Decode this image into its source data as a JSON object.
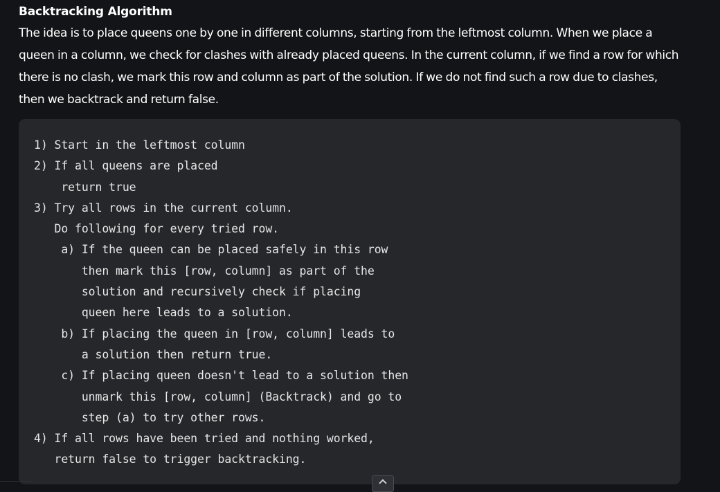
{
  "article": {
    "heading": "Backtracking Algorithm",
    "intro": "The idea is to place queens one by one in different columns, starting from the leftmost column. When we place a queen in a column, we check for clashes with already placed queens. In the current column, if we find a row for which there is no clash, we mark this row and column as part of the solution. If we do not find such a row due to clashes, then we backtrack and return false."
  },
  "code": {
    "lines": [
      "1) Start in the leftmost column",
      "2) If all queens are placed",
      "    return true",
      "3) Try all rows in the current column.",
      "   Do following for every tried row.",
      "    a) If the queen can be placed safely in this row",
      "       then mark this [row, column] as part of the",
      "       solution and recursively check if placing",
      "       queen here leads to a solution.",
      "    b) If placing the queen in [row, column] leads to",
      "       a solution then return true.",
      "    c) If placing queen doesn't lead to a solution then",
      "       unmark this [row, column] (Backtrack) and go to",
      "       step (a) to try other rows.",
      "4) If all rows have been tried and nothing worked,",
      "   return false to trigger backtracking."
    ]
  },
  "controls": {
    "scroll_top_icon": "chevron-up-icon"
  }
}
